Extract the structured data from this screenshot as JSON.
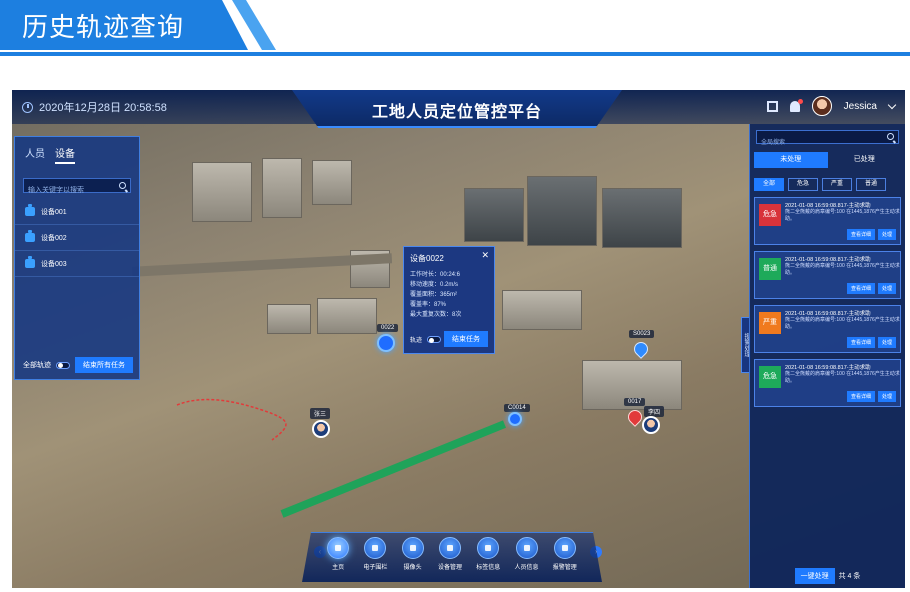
{
  "banner": {
    "title": "历史轨迹查询"
  },
  "header": {
    "datetime": "2020年12月28日  20:58:58",
    "title": "工地人员定位管控平台",
    "user": "Jessica"
  },
  "left_panel": {
    "tabs": [
      "人员",
      "设备"
    ],
    "active_tab": "设备",
    "search_placeholder": "输入关键字以搜索",
    "items": [
      "设备001",
      "设备002",
      "设备003"
    ],
    "all_track_label": "全部轨迹",
    "end_all_button": "结束所有任务"
  },
  "popup": {
    "title": "设备0022",
    "close": "✕",
    "rows": [
      "工作时长：00:24:6",
      "移动速度：0.2m/s",
      "覆盖面积：365m²",
      "覆盖率：87%",
      "最大重复次数：8次"
    ],
    "track_label": "轨迹",
    "end_button": "结束任务"
  },
  "markers": {
    "m0022": "0022",
    "m0023": "S0023",
    "m0014": "C0014",
    "m0017": "0017",
    "lisi": "李四",
    "zhangsan": "张三"
  },
  "right_panel": {
    "search_placeholder": "全局搜索",
    "tabs": [
      "未处理",
      "已处理"
    ],
    "active_tab": "未处理",
    "filters": [
      "全部",
      "危急",
      "严重",
      "普通"
    ],
    "active_filter": "全部",
    "side_tab": "报警处理",
    "cards": [
      {
        "level": "危急",
        "color": "#d8333a",
        "time": "2021-01-08 16:59:08.817-主动求助",
        "desc": "熊二全熊戴的肩章编号:100 在1445,1876产生主动求助。",
        "btn1": "查看详细",
        "btn2": "处理"
      },
      {
        "level": "普通",
        "color": "#1eaa5a",
        "time": "2021-01-08 16:59:08.817-主动求助",
        "desc": "熊二全熊戴的肩章编号:100 在1445,1876产生主动求助。",
        "btn1": "查看详细",
        "btn2": "处理"
      },
      {
        "level": "严重",
        "color": "#f07a1e",
        "time": "2021-01-08 16:59:08.817-主动求助",
        "desc": "熊二全熊戴的肩章编号:100 在1445,1876产生主动求助。",
        "btn1": "查看详细",
        "btn2": "处理"
      },
      {
        "level": "危急",
        "color": "#1eaa5a",
        "time": "2021-01-08 16:59:08.817-主动求助",
        "desc": "熊二全熊戴的肩章编号:100 在1445,1876产生主动求助。",
        "btn1": "查看详细",
        "btn2": "处理"
      }
    ],
    "footer_button": "一键处理",
    "footer_count": "共 4 条"
  },
  "bottom_nav": {
    "items": [
      "主页",
      "电子围栏",
      "摄像头",
      "设备管理",
      "标签信息",
      "人员信息",
      "报警管理"
    ],
    "active": "主页"
  }
}
